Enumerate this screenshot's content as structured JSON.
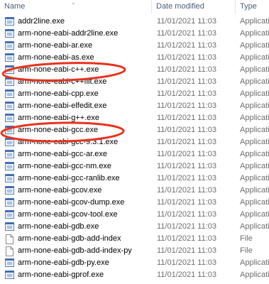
{
  "columns": {
    "name": "Name",
    "date": "Date modified",
    "type": "Type"
  },
  "files": [
    {
      "name": "addr2line.exe",
      "date": "11/01/2021 11:03",
      "type": "Applicatio",
      "icon": "exe-icon"
    },
    {
      "name": "arm-none-eabi-addr2line.exe",
      "date": "11/01/2021 11:03",
      "type": "Applicatio",
      "icon": "exe-icon"
    },
    {
      "name": "arm-none-eabi-ar.exe",
      "date": "11/01/2021 11:03",
      "type": "Applicatio",
      "icon": "exe-icon"
    },
    {
      "name": "arm-none-eabi-as.exe",
      "date": "11/01/2021 11:03",
      "type": "Applicatio",
      "icon": "exe-icon"
    },
    {
      "name": "arm-none-eabi-c++.exe",
      "date": "11/01/2021 11:03",
      "type": "Applicatio",
      "icon": "exe-icon"
    },
    {
      "name": "arm-none-eabi-c++filt.exe",
      "date": "11/01/2021 11:03",
      "type": "Applicatio",
      "icon": "exe-icon"
    },
    {
      "name": "arm-none-eabi-cpp.exe",
      "date": "11/01/2021 11:03",
      "type": "Applicatio",
      "icon": "exe-icon"
    },
    {
      "name": "arm-none-eabi-elfedit.exe",
      "date": "11/01/2021 11:03",
      "type": "Applicatio",
      "icon": "exe-icon"
    },
    {
      "name": "arm-none-eabi-g++.exe",
      "date": "11/01/2021 11:03",
      "type": "Applicatio",
      "icon": "exe-icon"
    },
    {
      "name": "arm-none-eabi-gcc.exe",
      "date": "11/01/2021 11:03",
      "type": "Applicatio",
      "icon": "exe-icon"
    },
    {
      "name": "arm-none-eabi-gcc-9.3.1.exe",
      "date": "11/01/2021 11:03",
      "type": "Applicatio",
      "icon": "exe-icon"
    },
    {
      "name": "arm-none-eabi-gcc-ar.exe",
      "date": "11/01/2021 11:03",
      "type": "Applicatio",
      "icon": "exe-icon"
    },
    {
      "name": "arm-none-eabi-gcc-nm.exe",
      "date": "11/01/2021 11:03",
      "type": "Applicatio",
      "icon": "exe-icon"
    },
    {
      "name": "arm-none-eabi-gcc-ranlib.exe",
      "date": "11/01/2021 11:03",
      "type": "Applicatio",
      "icon": "exe-icon"
    },
    {
      "name": "arm-none-eabi-gcov.exe",
      "date": "11/01/2021 11:03",
      "type": "Applicatio",
      "icon": "exe-icon"
    },
    {
      "name": "arm-none-eabi-gcov-dump.exe",
      "date": "11/01/2021 11:03",
      "type": "Applicatio",
      "icon": "exe-icon"
    },
    {
      "name": "arm-none-eabi-gcov-tool.exe",
      "date": "11/01/2021 11:03",
      "type": "Applicatio",
      "icon": "exe-icon"
    },
    {
      "name": "arm-none-eabi-gdb.exe",
      "date": "11/01/2021 11:03",
      "type": "Applicatio",
      "icon": "exe-icon"
    },
    {
      "name": "arm-none-eabi-gdb-add-index",
      "date": "11/01/2021 11:03",
      "type": "File",
      "icon": "file-icon"
    },
    {
      "name": "arm-none-eabi-gdb-add-index-py",
      "date": "11/01/2021 11:03",
      "type": "File",
      "icon": "file-icon"
    },
    {
      "name": "arm-none-eabi-gdb-py.exe",
      "date": "11/01/2021 11:03",
      "type": "Applicatio",
      "icon": "exe-icon"
    },
    {
      "name": "arm-none-eabi-gprof.exe",
      "date": "11/01/2021 11:03",
      "type": "Applicatio",
      "icon": "exe-icon"
    }
  ],
  "colors": {
    "annotation": "#e8321e",
    "header_text": "#4c607a",
    "meta_text": "#6d6d6d"
  }
}
